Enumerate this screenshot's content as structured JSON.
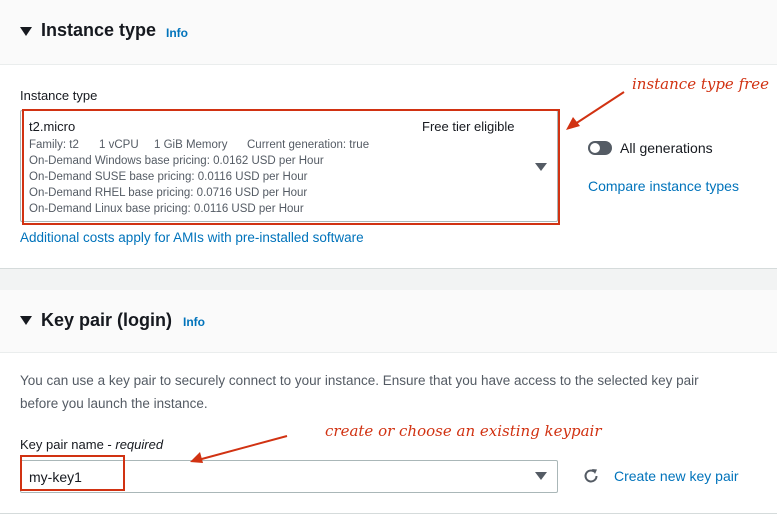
{
  "instance_section": {
    "title": "Instance type",
    "info": "Info",
    "field_label": "Instance type",
    "selected": {
      "name": "t2.micro",
      "badge": "Free tier eligible",
      "family": "Family: t2",
      "vcpu": "1 vCPU",
      "memory": "1 GiB Memory",
      "generation": "Current generation: true",
      "pricing": [
        "On-Demand Windows base pricing: 0.0162 USD per Hour",
        "On-Demand SUSE base pricing: 0.0116 USD per Hour",
        "On-Demand RHEL base pricing: 0.0716 USD per Hour",
        "On-Demand Linux base pricing: 0.0116 USD per Hour"
      ]
    },
    "additional_costs_link": "Additional costs apply for AMIs with pre-installed software",
    "all_generations_label": "All generations",
    "compare_link": "Compare instance types"
  },
  "keypair_section": {
    "title": "Key pair (login)",
    "info": "Info",
    "description_line1": "You can use a key pair to securely connect to your instance. Ensure that you have access to the selected key pair",
    "description_line2": "before you launch the instance.",
    "field_label": "Key pair name - ",
    "field_required": "required",
    "selected_value": "my-key1",
    "create_link": "Create new key pair"
  },
  "annotations": {
    "instance_note": "instance type free",
    "keypair_note": "create or choose an existing keypair",
    "color": "#d13212"
  },
  "colors": {
    "link": "#0073bb",
    "background": "#f2f3f3"
  }
}
